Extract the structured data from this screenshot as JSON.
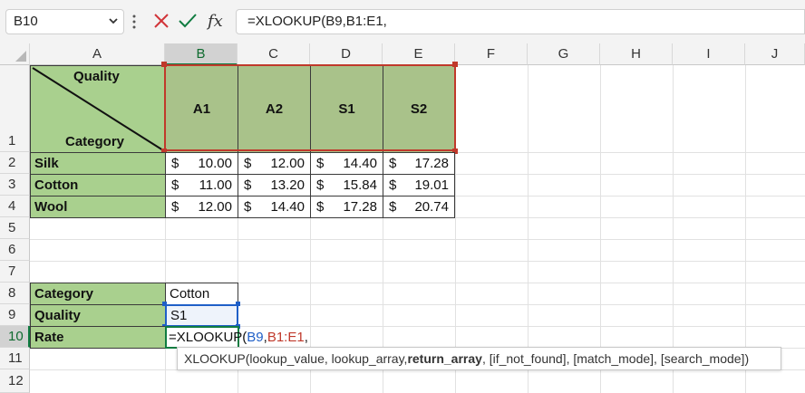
{
  "name_box": {
    "value": "B10"
  },
  "formula_bar": {
    "value": "=XLOOKUP(B9,B1:E1,"
  },
  "columns": [
    "A",
    "B",
    "C",
    "D",
    "E",
    "F",
    "G",
    "H",
    "I",
    "J"
  ],
  "rows": [
    "1",
    "2",
    "3",
    "4",
    "5",
    "6",
    "7",
    "8",
    "9",
    "10",
    "11",
    "12"
  ],
  "table": {
    "corner_top": "Quality",
    "corner_bottom": "Category",
    "headers": [
      "A1",
      "A2",
      "S1",
      "S2"
    ],
    "currency": "$",
    "data": [
      {
        "label": "Silk",
        "values": [
          "10.00",
          "12.00",
          "14.40",
          "17.28"
        ]
      },
      {
        "label": "Cotton",
        "values": [
          "11.00",
          "13.20",
          "15.84",
          "19.01"
        ]
      },
      {
        "label": "Wool",
        "values": [
          "12.00",
          "14.40",
          "17.28",
          "20.74"
        ]
      }
    ]
  },
  "lookup": {
    "category_label": "Category",
    "category_value": "Cotton",
    "quality_label": "Quality",
    "quality_value": "S1",
    "rate_label": "Rate",
    "rate_formula": {
      "p0": "=XLOOKUP(",
      "ref1": "B9",
      "p1": ",",
      "ref2": "B1:E1",
      "p2": ","
    }
  },
  "tooltip": {
    "fn": "XLOOKUP(",
    "a1": "lookup_value, lookup_array, ",
    "bold": "return_array",
    "a2": ", [if_not_found], [match_mode], [search_mode])"
  },
  "colors": {
    "label_fill": "#a9d08e",
    "header_fill": "#a9c28a",
    "ref_blue": "#1f5fc7",
    "ref_red": "#c0392b",
    "active_green": "#107c41",
    "cancel_red": "#d13438"
  }
}
